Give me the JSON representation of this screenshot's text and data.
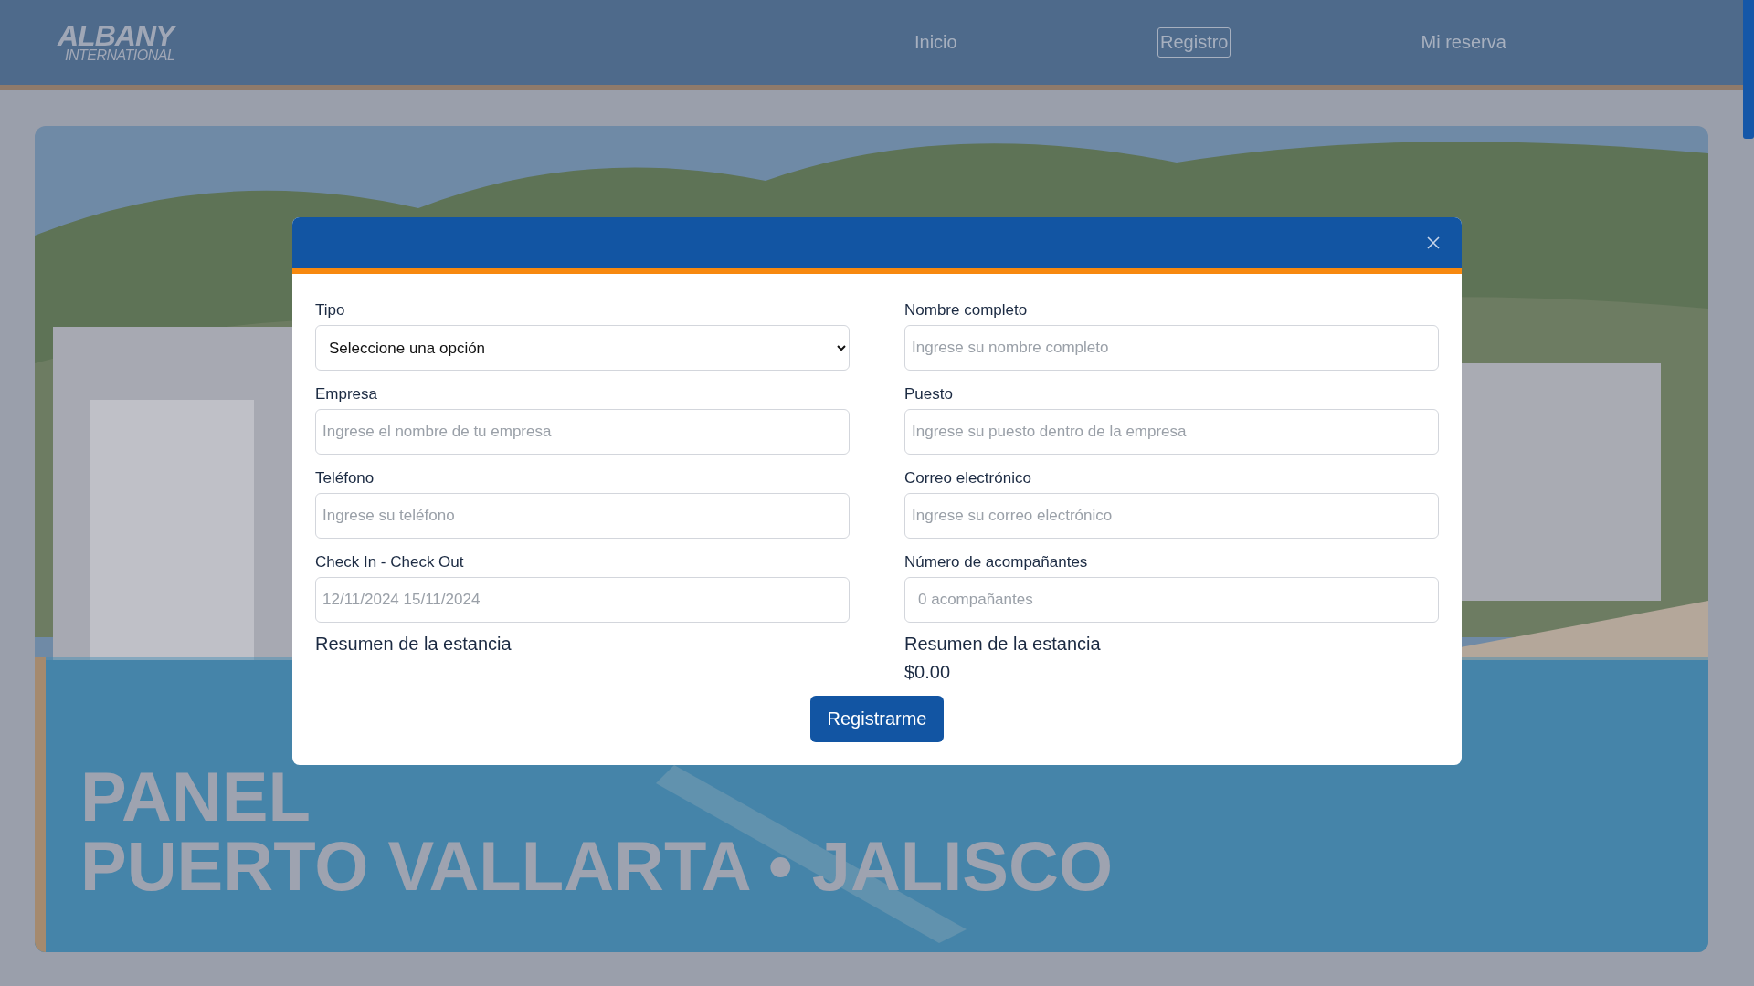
{
  "header": {
    "logo": {
      "main": "ALBANY",
      "sub": "INTERNATIONAL"
    },
    "nav": [
      {
        "label": "Inicio",
        "selected": false
      },
      {
        "label": "Registro",
        "selected": true
      },
      {
        "label": "Mi reserva",
        "selected": false
      }
    ]
  },
  "hero": {
    "kind": "picture",
    "title_visible": "PANEL",
    "subtitle": "PUERTO VALLARTA • JALISCO"
  },
  "modal": {
    "columns": [
      {
        "fields": [
          {
            "kind": "select",
            "label": "Tipo",
            "value": "Seleccione una opción"
          },
          {
            "kind": "input",
            "label": "Empresa",
            "placeholder": "Ingrese el nombre de tu empresa"
          },
          {
            "kind": "input",
            "label": "Teléfono",
            "placeholder": "Ingrese su teléfono"
          },
          {
            "kind": "input",
            "label": "Check In - Check Out",
            "placeholder": "12/11/2024 15/11/2024"
          }
        ],
        "summary": {
          "title": "Resumen de la estancia"
        }
      },
      {
        "fields": [
          {
            "kind": "input",
            "label": "Nombre completo",
            "placeholder": "Ingrese su nombre completo"
          },
          {
            "kind": "input",
            "label": "Puesto",
            "placeholder": "Ingrese su puesto dentro de la empresa"
          },
          {
            "kind": "input",
            "label": "Correo electrónico",
            "placeholder": "Ingrese su correo electrónico"
          },
          {
            "kind": "number",
            "label": "Número de acompañantes",
            "placeholder": "0 acompañantes"
          }
        ],
        "summary": {
          "title": "Resumen de la estancia",
          "total": "$0.00"
        }
      }
    ],
    "submit": "Registrarme"
  }
}
